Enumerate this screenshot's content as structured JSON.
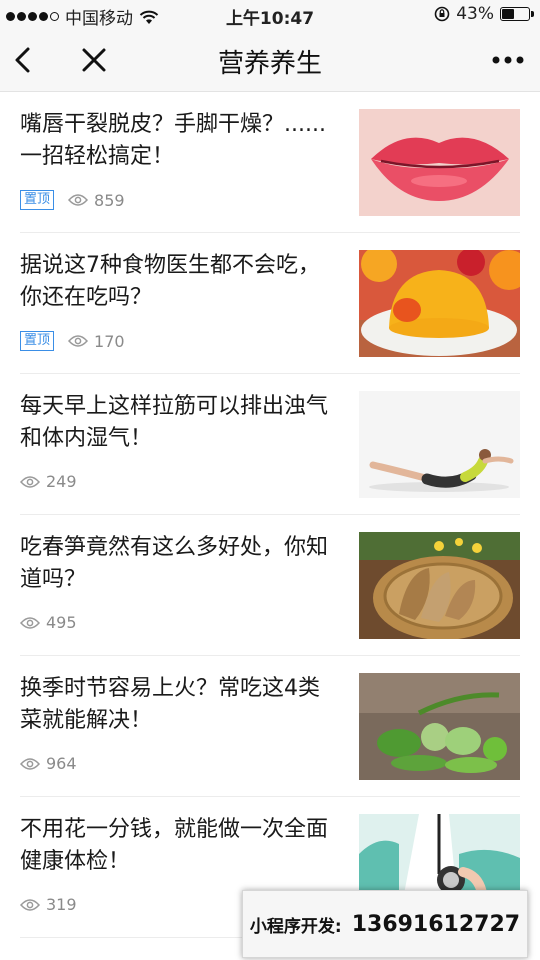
{
  "status_bar": {
    "carrier": "中国移动",
    "time": "上午10:47",
    "battery": "43%",
    "battery_level": 0.43
  },
  "nav": {
    "title": "营养养生"
  },
  "articles": [
    {
      "title": "嘴唇干裂脱皮？手脚干燥？......一招轻松搞定！",
      "pinned": true,
      "pin_label": "置顶",
      "views": "859",
      "image": "red-lips-photo"
    },
    {
      "title": "据说这7种食物医生都不会吃，你还在吃吗？",
      "pinned": true,
      "pin_label": "置顶",
      "views": "170",
      "image": "jelly-dessert-photo"
    },
    {
      "title": "每天早上这样拉筋可以排出浊气和体内湿气！",
      "pinned": false,
      "views": "249",
      "image": "stretching-woman-photo"
    },
    {
      "title": "吃春笋竟然有这么多好处，你知道吗？",
      "pinned": false,
      "views": "495",
      "image": "bamboo-shoots-basket-photo"
    },
    {
      "title": "换季时节容易上火？常吃这4类菜就能解决！",
      "pinned": false,
      "views": "964",
      "image": "green-vegetables-photo"
    },
    {
      "title": "不用花一分钱，就能做一次全面健康体检！",
      "pinned": false,
      "views": "319",
      "image": "doctor-stethoscope-photo"
    }
  ],
  "promo": {
    "label": "小程序开发:",
    "phone": "13691612727"
  }
}
